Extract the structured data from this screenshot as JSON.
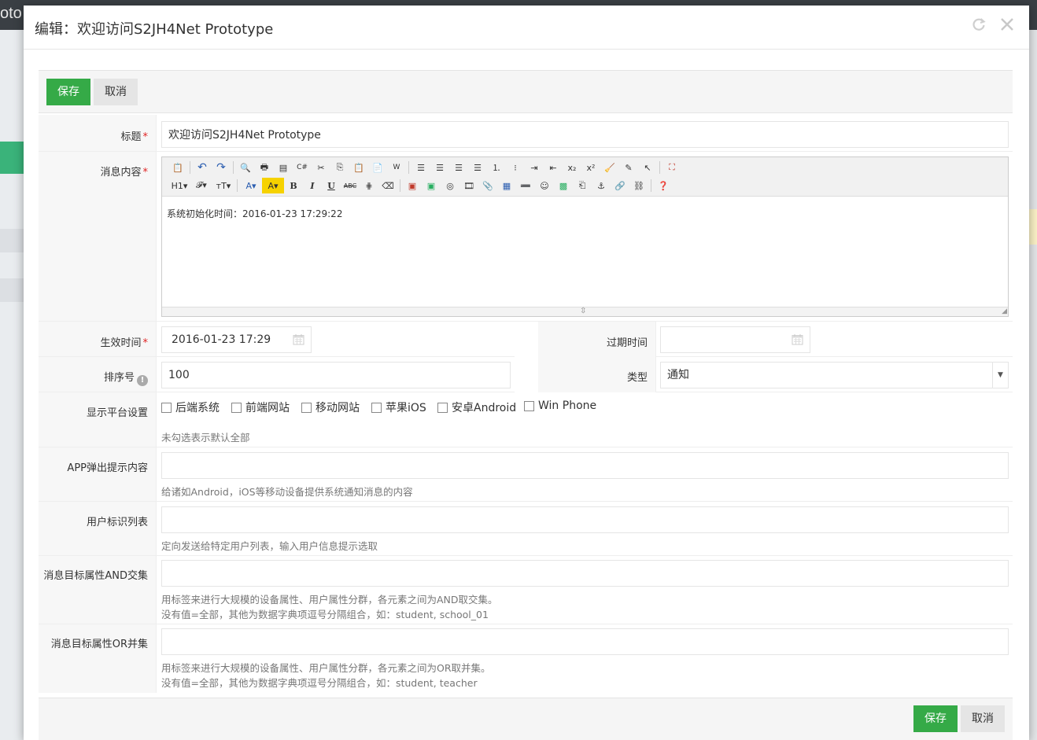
{
  "background": {
    "brand_fragment": "oto"
  },
  "modal": {
    "title": "编辑：欢迎访问S2JH4Net Prototype",
    "refresh_icon": "refresh-icon",
    "close_icon": "close-icon"
  },
  "actions": {
    "save_label": "保存",
    "cancel_label": "取消"
  },
  "form": {
    "title": {
      "label": "标题",
      "required": "*",
      "value": "欢迎访问S2JH4Net Prototype"
    },
    "content": {
      "label": "消息内容",
      "required": "*",
      "body": "系统初始化时间：2016-01-23 17:29:22",
      "toolbar_row1": [
        "source-icon",
        "undo-icon",
        "redo-icon",
        "preview-icon",
        "print-icon",
        "template-icon",
        "code-icon",
        "cut-icon",
        "copy-icon",
        "paste-icon",
        "paste-text-icon",
        "paste-word-icon",
        "align-left-icon",
        "align-center-icon",
        "align-right-icon",
        "align-justify-icon",
        "ordered-list-icon",
        "unordered-list-icon",
        "indent-icon",
        "outdent-icon",
        "subscript-icon",
        "superscript-icon",
        "clear-format-icon",
        "select-all-icon",
        "cursor-icon",
        "fullscreen-icon"
      ],
      "toolbar_row2_text": {
        "heading": "H1▾",
        "font": "𝓕▾",
        "size": "тT▾",
        "forecolor": "A▾",
        "hilite": "A▾",
        "bold": "B",
        "italic": "I",
        "underline": "U",
        "strike": "ABC"
      }
    },
    "effective_time": {
      "label": "生效时间",
      "required": "*",
      "value": "2016-01-23 17:29"
    },
    "expire_time": {
      "label": "过期时间",
      "value": ""
    },
    "order": {
      "label": "排序号",
      "value": "100"
    },
    "type": {
      "label": "类型",
      "value": "通知"
    },
    "platform": {
      "label": "显示平台设置",
      "options": [
        "后端系统",
        "前端网站",
        "移动网站",
        "苹果iOS",
        "安卓Android",
        "Win Phone"
      ],
      "hint": "未勾选表示默认全部"
    },
    "app_popup": {
      "label": "APP弹出提示内容",
      "value": "",
      "hint": "给诸如Android，iOS等移动设备提供系统通知消息的内容"
    },
    "user_list": {
      "label": "用户标识列表",
      "value": "",
      "hint": "定向发送给特定用户列表，输入用户信息提示选取"
    },
    "and_tags": {
      "label": "消息目标属性AND交集",
      "value": "",
      "hint1": "用标签来进行大规模的设备属性、用户属性分群，各元素之间为AND取交集。",
      "hint2": "没有值=全部，其他为数据字典项逗号分隔组合，如：student, school_01"
    },
    "or_tags": {
      "label": "消息目标属性OR并集",
      "value": "",
      "hint1": "用标签来进行大规模的设备属性、用户属性分群，各元素之间为OR取并集。",
      "hint2": "没有值=全部，其他为数据字典项逗号分隔组合，如：student, teacher"
    }
  }
}
